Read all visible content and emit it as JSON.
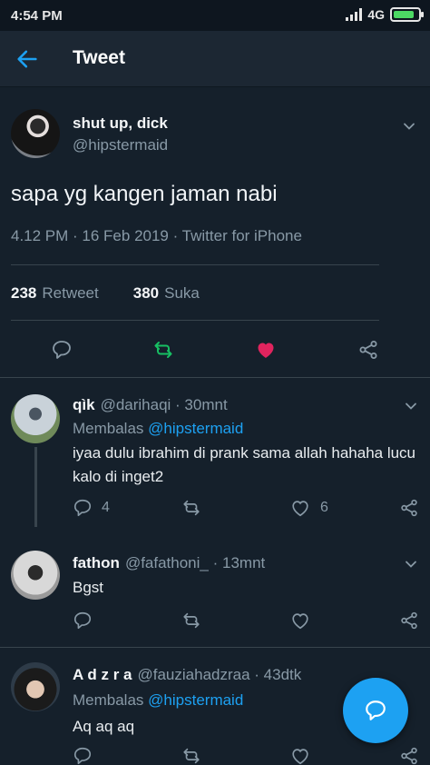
{
  "status_bar": {
    "time": "4:54 PM",
    "network": "4G",
    "battery_level": 0.85
  },
  "header": {
    "title": "Tweet"
  },
  "tweet": {
    "display_name": "shut up, dick",
    "handle": "@hipstermaid",
    "text": "sapa yg kangen jaman nabi",
    "meta": "4.12 PM · 16 Feb 2019 · Twitter for iPhone",
    "retweets": "238",
    "retweets_label": "Retweet",
    "likes": "380",
    "likes_label": "Suka"
  },
  "replies": [
    {
      "display_name": "qìk",
      "handle": "@darihaqi",
      "time": "· 30mnt",
      "replying_label": "Membalas",
      "replying_to": "@hipstermaid",
      "text": "iyaa dulu ibrahim di prank sama allah hahaha lucu kalo di inget2",
      "reply_count": "4",
      "like_count": "6"
    },
    {
      "display_name": "fathon",
      "handle": "@fafathoni_",
      "time": "· 13mnt",
      "text": "Bgst"
    },
    {
      "display_name": "A d z r a",
      "handle": "@fauziahadzraa",
      "time": "· 43dtk",
      "replying_label": "Membalas",
      "replying_to": "@hipstermaid",
      "text": "Aq aq aq"
    }
  ],
  "colors": {
    "accent": "#1da1f2",
    "retweet": "#17bf63",
    "like": "#e0245e",
    "background": "#15202b",
    "muted": "#8899a6"
  }
}
